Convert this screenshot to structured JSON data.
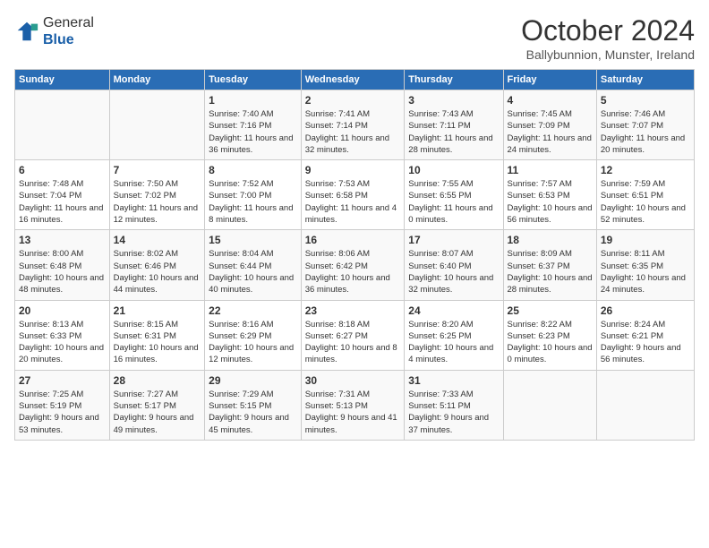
{
  "logo": {
    "general": "General",
    "blue": "Blue"
  },
  "header": {
    "month": "October 2024",
    "location": "Ballybunnion, Munster, Ireland"
  },
  "days_of_week": [
    "Sunday",
    "Monday",
    "Tuesday",
    "Wednesday",
    "Thursday",
    "Friday",
    "Saturday"
  ],
  "weeks": [
    [
      {
        "day": "",
        "sunrise": "",
        "sunset": "",
        "daylight": ""
      },
      {
        "day": "",
        "sunrise": "",
        "sunset": "",
        "daylight": ""
      },
      {
        "day": "1",
        "sunrise": "Sunrise: 7:40 AM",
        "sunset": "Sunset: 7:16 PM",
        "daylight": "Daylight: 11 hours and 36 minutes."
      },
      {
        "day": "2",
        "sunrise": "Sunrise: 7:41 AM",
        "sunset": "Sunset: 7:14 PM",
        "daylight": "Daylight: 11 hours and 32 minutes."
      },
      {
        "day": "3",
        "sunrise": "Sunrise: 7:43 AM",
        "sunset": "Sunset: 7:11 PM",
        "daylight": "Daylight: 11 hours and 28 minutes."
      },
      {
        "day": "4",
        "sunrise": "Sunrise: 7:45 AM",
        "sunset": "Sunset: 7:09 PM",
        "daylight": "Daylight: 11 hours and 24 minutes."
      },
      {
        "day": "5",
        "sunrise": "Sunrise: 7:46 AM",
        "sunset": "Sunset: 7:07 PM",
        "daylight": "Daylight: 11 hours and 20 minutes."
      }
    ],
    [
      {
        "day": "6",
        "sunrise": "Sunrise: 7:48 AM",
        "sunset": "Sunset: 7:04 PM",
        "daylight": "Daylight: 11 hours and 16 minutes."
      },
      {
        "day": "7",
        "sunrise": "Sunrise: 7:50 AM",
        "sunset": "Sunset: 7:02 PM",
        "daylight": "Daylight: 11 hours and 12 minutes."
      },
      {
        "day": "8",
        "sunrise": "Sunrise: 7:52 AM",
        "sunset": "Sunset: 7:00 PM",
        "daylight": "Daylight: 11 hours and 8 minutes."
      },
      {
        "day": "9",
        "sunrise": "Sunrise: 7:53 AM",
        "sunset": "Sunset: 6:58 PM",
        "daylight": "Daylight: 11 hours and 4 minutes."
      },
      {
        "day": "10",
        "sunrise": "Sunrise: 7:55 AM",
        "sunset": "Sunset: 6:55 PM",
        "daylight": "Daylight: 11 hours and 0 minutes."
      },
      {
        "day": "11",
        "sunrise": "Sunrise: 7:57 AM",
        "sunset": "Sunset: 6:53 PM",
        "daylight": "Daylight: 10 hours and 56 minutes."
      },
      {
        "day": "12",
        "sunrise": "Sunrise: 7:59 AM",
        "sunset": "Sunset: 6:51 PM",
        "daylight": "Daylight: 10 hours and 52 minutes."
      }
    ],
    [
      {
        "day": "13",
        "sunrise": "Sunrise: 8:00 AM",
        "sunset": "Sunset: 6:48 PM",
        "daylight": "Daylight: 10 hours and 48 minutes."
      },
      {
        "day": "14",
        "sunrise": "Sunrise: 8:02 AM",
        "sunset": "Sunset: 6:46 PM",
        "daylight": "Daylight: 10 hours and 44 minutes."
      },
      {
        "day": "15",
        "sunrise": "Sunrise: 8:04 AM",
        "sunset": "Sunset: 6:44 PM",
        "daylight": "Daylight: 10 hours and 40 minutes."
      },
      {
        "day": "16",
        "sunrise": "Sunrise: 8:06 AM",
        "sunset": "Sunset: 6:42 PM",
        "daylight": "Daylight: 10 hours and 36 minutes."
      },
      {
        "day": "17",
        "sunrise": "Sunrise: 8:07 AM",
        "sunset": "Sunset: 6:40 PM",
        "daylight": "Daylight: 10 hours and 32 minutes."
      },
      {
        "day": "18",
        "sunrise": "Sunrise: 8:09 AM",
        "sunset": "Sunset: 6:37 PM",
        "daylight": "Daylight: 10 hours and 28 minutes."
      },
      {
        "day": "19",
        "sunrise": "Sunrise: 8:11 AM",
        "sunset": "Sunset: 6:35 PM",
        "daylight": "Daylight: 10 hours and 24 minutes."
      }
    ],
    [
      {
        "day": "20",
        "sunrise": "Sunrise: 8:13 AM",
        "sunset": "Sunset: 6:33 PM",
        "daylight": "Daylight: 10 hours and 20 minutes."
      },
      {
        "day": "21",
        "sunrise": "Sunrise: 8:15 AM",
        "sunset": "Sunset: 6:31 PM",
        "daylight": "Daylight: 10 hours and 16 minutes."
      },
      {
        "day": "22",
        "sunrise": "Sunrise: 8:16 AM",
        "sunset": "Sunset: 6:29 PM",
        "daylight": "Daylight: 10 hours and 12 minutes."
      },
      {
        "day": "23",
        "sunrise": "Sunrise: 8:18 AM",
        "sunset": "Sunset: 6:27 PM",
        "daylight": "Daylight: 10 hours and 8 minutes."
      },
      {
        "day": "24",
        "sunrise": "Sunrise: 8:20 AM",
        "sunset": "Sunset: 6:25 PM",
        "daylight": "Daylight: 10 hours and 4 minutes."
      },
      {
        "day": "25",
        "sunrise": "Sunrise: 8:22 AM",
        "sunset": "Sunset: 6:23 PM",
        "daylight": "Daylight: 10 hours and 0 minutes."
      },
      {
        "day": "26",
        "sunrise": "Sunrise: 8:24 AM",
        "sunset": "Sunset: 6:21 PM",
        "daylight": "Daylight: 9 hours and 56 minutes."
      }
    ],
    [
      {
        "day": "27",
        "sunrise": "Sunrise: 7:25 AM",
        "sunset": "Sunset: 5:19 PM",
        "daylight": "Daylight: 9 hours and 53 minutes."
      },
      {
        "day": "28",
        "sunrise": "Sunrise: 7:27 AM",
        "sunset": "Sunset: 5:17 PM",
        "daylight": "Daylight: 9 hours and 49 minutes."
      },
      {
        "day": "29",
        "sunrise": "Sunrise: 7:29 AM",
        "sunset": "Sunset: 5:15 PM",
        "daylight": "Daylight: 9 hours and 45 minutes."
      },
      {
        "day": "30",
        "sunrise": "Sunrise: 7:31 AM",
        "sunset": "Sunset: 5:13 PM",
        "daylight": "Daylight: 9 hours and 41 minutes."
      },
      {
        "day": "31",
        "sunrise": "Sunrise: 7:33 AM",
        "sunset": "Sunset: 5:11 PM",
        "daylight": "Daylight: 9 hours and 37 minutes."
      },
      {
        "day": "",
        "sunrise": "",
        "sunset": "",
        "daylight": ""
      },
      {
        "day": "",
        "sunrise": "",
        "sunset": "",
        "daylight": ""
      }
    ]
  ]
}
